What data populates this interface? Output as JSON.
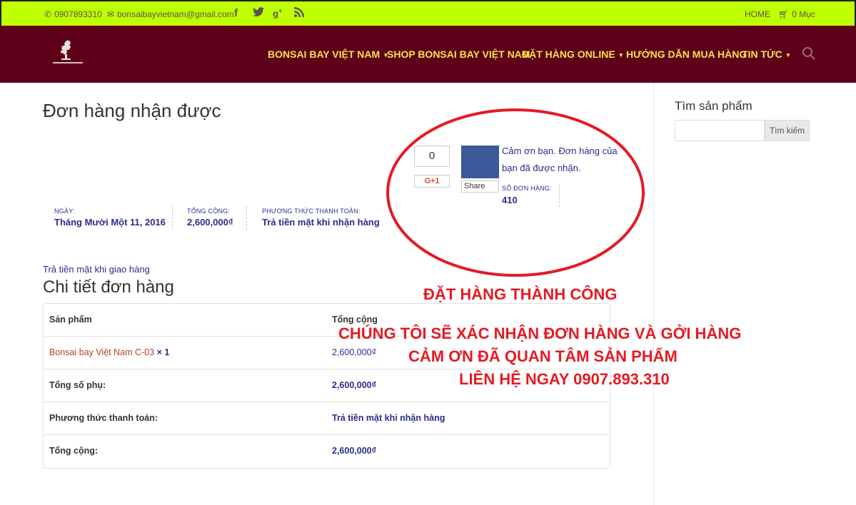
{
  "topbar": {
    "phone": "0907893310",
    "email": "bonsaibayvietnam@gmail.com",
    "home_label": "HOME",
    "cart_label": "0 Mục"
  },
  "nav": {
    "items": [
      {
        "label": "BONSAI BAY VIỆT NAM"
      },
      {
        "label": "SHOP BONSAI BAY VIỆT NAM"
      },
      {
        "label": "ĐẶT HÀNG ONLINE"
      },
      {
        "label": "HƯỚNG DẪN MUA HÀNG"
      },
      {
        "label": "TIN TỨC"
      }
    ]
  },
  "page": {
    "title": "Đơn hàng nhận được",
    "thanks": "Cảm ơn bạn. Đơn hàng của bạn đã được nhận.",
    "payment_note": "Trả tiền mặt khi giao hàng",
    "details_title": "Chi tiết đơn hàng"
  },
  "share": {
    "count": "0",
    "gplus_label": "G+1",
    "fb_share_label": "Share"
  },
  "order_meta": {
    "number_label": "SỐ ĐƠN HÀNG:",
    "number": "410",
    "date_label": "NGÀY:",
    "date": "Tháng Mười Một 11, 2016",
    "total_label": "TỔNG CỘNG:",
    "total": "2,600,000₫",
    "payment_label": "PHƯƠNG THỨC THANH TOÁN:",
    "payment": "Trả tiền mặt khi nhận hàng"
  },
  "table": {
    "header": {
      "product": "Sản phẩm",
      "total": "Tổng cộng"
    },
    "item": {
      "name": "Bonsai bay Việt Nam C-03",
      "qty": "× 1",
      "total": "2,600,000₫"
    },
    "subtotal": {
      "label": "Tổng số phụ:",
      "value": "2,600,000₫"
    },
    "payment": {
      "label": "Phương thức thanh toán:",
      "value": "Trả tiền mặt khi nhận hàng"
    },
    "grand_total": {
      "label": "Tổng cộng:",
      "value": "2,600,000₫"
    }
  },
  "sidebar": {
    "search_title": "Tìm sản phẩm",
    "search_placeholder": "",
    "search_button": "Tìm kiếm"
  },
  "overlay": {
    "line1": "ĐẶT HÀNG THÀNH CÔNG",
    "line2": "CHÚNG TÔI SẼ XÁC NHẬN ĐƠN HÀNG VÀ GỞI HÀNG",
    "line3": "CẢM ƠN ĐÃ QUAN TÂM SẢN PHẨM",
    "line4": "LIÊN HỆ NGAY 0907.893.310"
  },
  "colors": {
    "topbar": "#bfff00",
    "navbar": "#5e0019",
    "nav_text": "#f5e04a",
    "accent_text": "#2b2b8c",
    "overlay_red": "#e31b23"
  },
  "icons": [
    "phone-icon",
    "mail-icon",
    "facebook-icon",
    "twitter-icon",
    "google-plus-icon",
    "rss-icon",
    "cart-icon",
    "search-icon"
  ]
}
